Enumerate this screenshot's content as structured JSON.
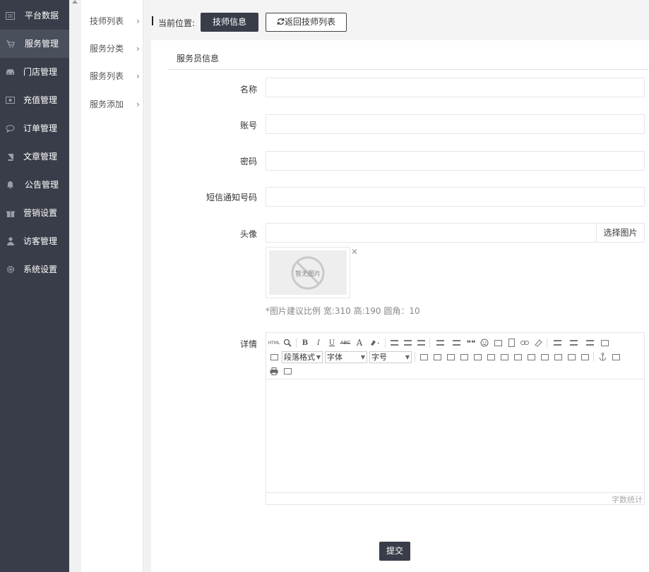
{
  "sidebar": {
    "items": [
      {
        "label": "平台数据",
        "icon": "dashboard-icon"
      },
      {
        "label": "服务管理",
        "icon": "cart-icon"
      },
      {
        "label": "门店管理",
        "icon": "car-icon"
      },
      {
        "label": "充值管理",
        "icon": "money-icon"
      },
      {
        "label": "订单管理",
        "icon": "chat-icon"
      },
      {
        "label": "文章管理",
        "icon": "book-icon"
      },
      {
        "label": "公告管理",
        "icon": "bell-icon"
      },
      {
        "label": "营销设置",
        "icon": "gift-icon"
      },
      {
        "label": "访客管理",
        "icon": "user-icon"
      },
      {
        "label": "系统设置",
        "icon": "gear-icon"
      }
    ],
    "active_index": 1
  },
  "submenu": {
    "items": [
      {
        "label": "技师列表"
      },
      {
        "label": "服务分类"
      },
      {
        "label": "服务列表"
      },
      {
        "label": "服务添加"
      }
    ],
    "arrow": "›"
  },
  "breadcrumb": {
    "label": "当前位置:",
    "current": "技师信息",
    "back": "返回技师列表",
    "back_icon": "refresh-icon"
  },
  "panel": {
    "tab": "服务员信息"
  },
  "form": {
    "name": {
      "label": "名称",
      "value": ""
    },
    "account": {
      "label": "账号",
      "value": ""
    },
    "password": {
      "label": "密码",
      "value": ""
    },
    "sms_phone": {
      "label": "短信通知号码",
      "value": ""
    },
    "avatar": {
      "label": "头像",
      "value": "",
      "pick": "选择图片",
      "placeholder_text": "暂无图片",
      "close": "✕",
      "hint": "*图片建议比例 宽:310 高:190 圆角：10"
    },
    "detail": {
      "label": "详情",
      "para_format": "段落格式",
      "font": "字体",
      "font_size": "字号",
      "word_count": "字数统计",
      "toolbar_source": "HTML",
      "toolbar_bold": "B",
      "toolbar_italic": "I",
      "toolbar_underline": "U",
      "toolbar_strike": "ABC",
      "toolbar_fontcolor": "A",
      "toolbar_quote": "❝❝"
    },
    "submit": "提交"
  }
}
